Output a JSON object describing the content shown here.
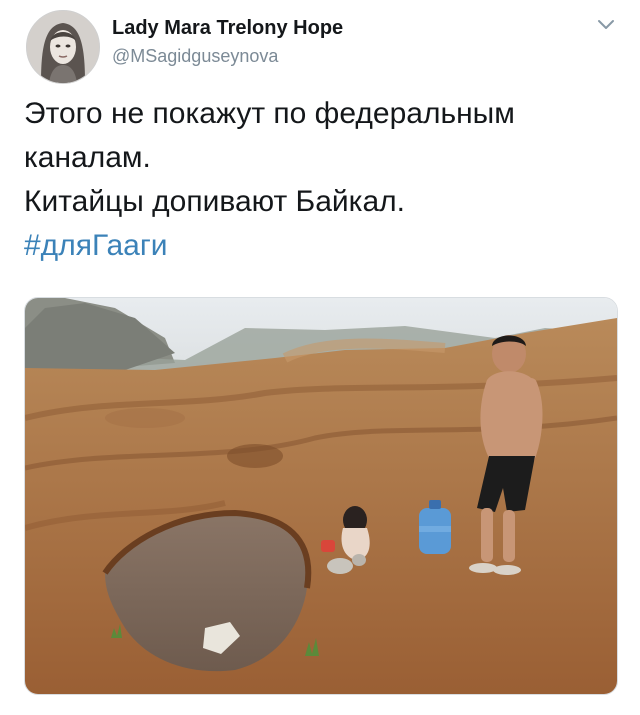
{
  "author": {
    "name": "Lady Mara Trelony Hope",
    "handle": "@MSagidguseynova"
  },
  "tweet": {
    "lines": [
      "Этого не покажут по федеральным",
      "каналам.",
      "Китайцы допивают Байкал."
    ],
    "hashtag": "#дляГааги"
  },
  "icons": {
    "menu": "chevron-down-icon"
  },
  "colors": {
    "text": "#14171a",
    "secondary": "#7c8a96",
    "link": "#3b82b8"
  }
}
